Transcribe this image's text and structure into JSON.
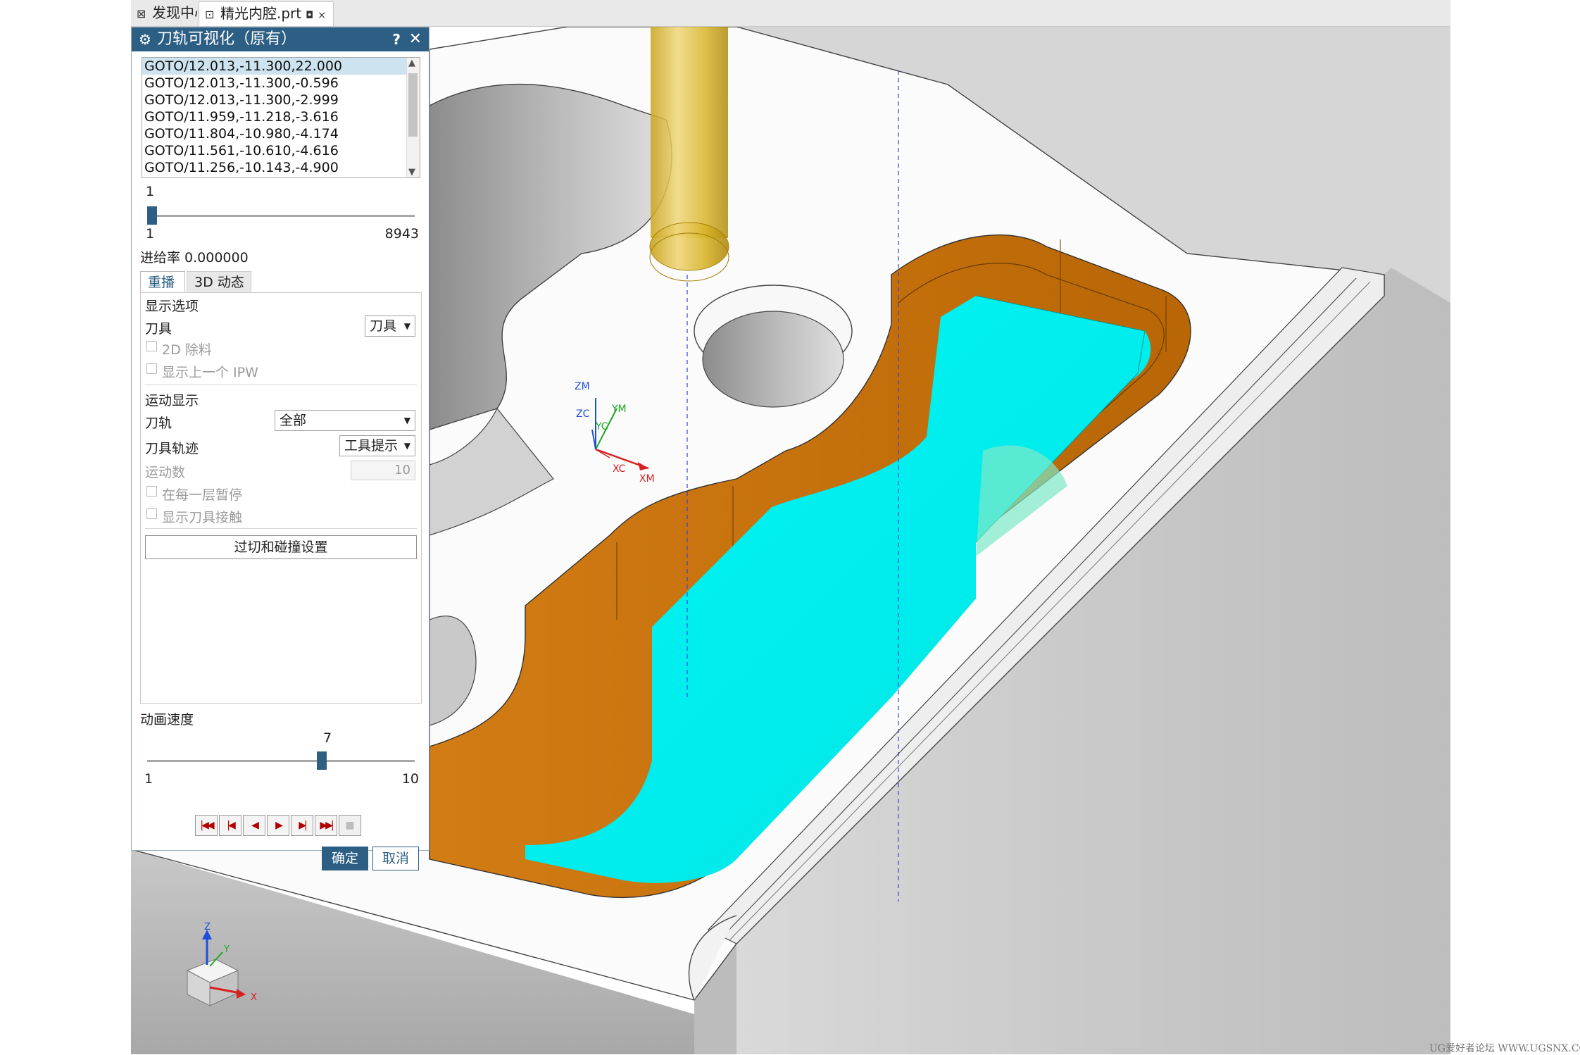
{
  "tabs": [
    {
      "label": "发现中心",
      "icon": "discovery-icon"
    },
    {
      "label": "精光内腔.prt",
      "icon": "part-file-icon",
      "pin": "◘",
      "close": "×"
    }
  ],
  "dialog": {
    "title": "刀轨可视化（原有）",
    "help": "?",
    "close": "✕",
    "goto_lines": [
      "GOTO/12.013,-11.300,22.000",
      "GOTO/12.013,-11.300,-0.596",
      "GOTO/12.013,-11.300,-2.999",
      "GOTO/11.959,-11.218,-3.616",
      "GOTO/11.804,-10.980,-4.174",
      "GOTO/11.561,-10.610,-4.616",
      "GOTO/11.256,-10.143,-4.900"
    ],
    "selected_goto": 0,
    "motion_slider": {
      "value": "1",
      "min": "1",
      "max": "8943",
      "position": 0
    },
    "feed_rate": "进给率 0.000000",
    "subtabs": {
      "replay": "重播",
      "dynamic": "3D 动态",
      "active": "replay"
    },
    "display_options": {
      "heading": "显示选项",
      "tool_label": "刀具",
      "tool_value": "刀具",
      "cb_2d": "2D 除料",
      "cb_prev_ipw": "显示上一个 IPW"
    },
    "motion_display": {
      "heading": "运动显示",
      "path_label": "刀轨",
      "path_value": "全部",
      "trace_label": "刀具轨迹",
      "trace_value": "工具提示",
      "count_label": "运动数",
      "count_value": "10",
      "cb_pause": "在每一层暂停",
      "cb_contact": "显示刀具接触"
    },
    "gouge_button": "过切和碰撞设置",
    "anim_speed": {
      "label": "动画速度",
      "value": "7",
      "min": "1",
      "max": "10",
      "fraction": 0.6667
    },
    "ok": "确定",
    "cancel": "取消"
  },
  "wcs_labels": {
    "zm": "ZM",
    "zc": "ZC",
    "yc": "YC",
    "ym": "YM",
    "xc": "XC",
    "xm": "XM"
  },
  "triad_labels": {
    "z": "Z",
    "y": "Y",
    "x": "X"
  },
  "watermark": "UG爱好者论坛 WWW.UGSNX.COM",
  "colors": {
    "title_bar": "#2d5f84",
    "wall_orange": "#c8720a",
    "toolpath_cyan": "#00f0f0",
    "tool_yellow": "#d8b52a",
    "axis_z": "#1f4fd8",
    "axis_x": "#d82020",
    "axis_y": "#1fa81f"
  }
}
